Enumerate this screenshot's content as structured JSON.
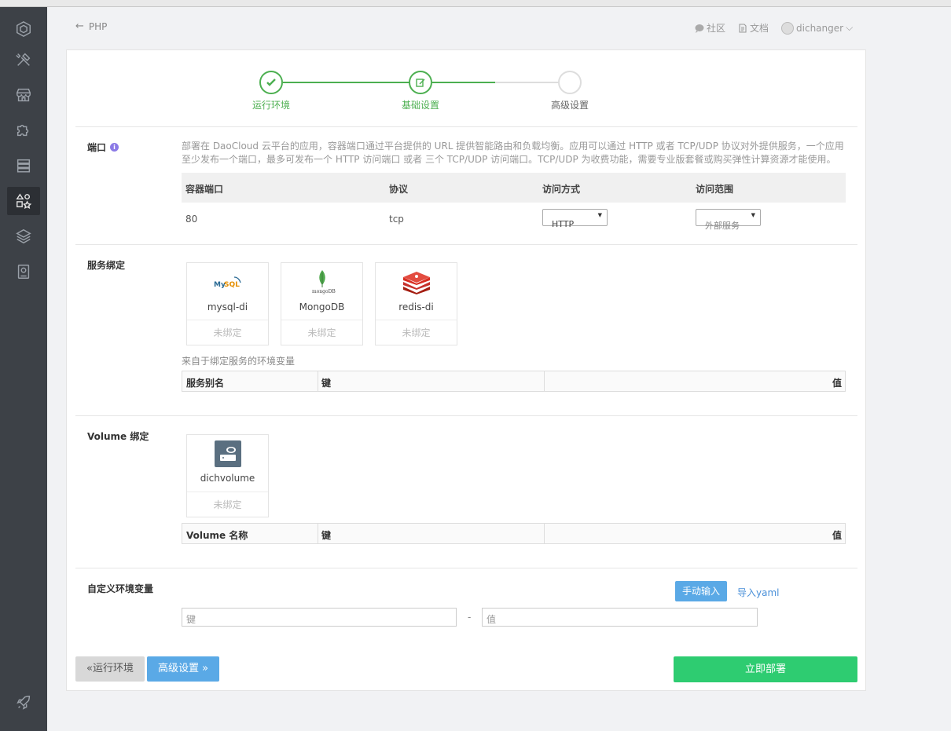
{
  "sidebar": {
    "items": [
      {
        "icon": "cube-logo-icon"
      },
      {
        "icon": "tools-icon"
      },
      {
        "icon": "store-icon"
      },
      {
        "icon": "puzzle-icon"
      },
      {
        "icon": "server-list-icon"
      },
      {
        "icon": "shapes-icon",
        "active": true
      },
      {
        "icon": "layers-icon"
      },
      {
        "icon": "disk-icon"
      },
      {
        "icon": "rocket-icon"
      }
    ]
  },
  "header": {
    "back_label": "PHP",
    "community": "社区",
    "docs": "文档",
    "user": "dichanger"
  },
  "steps": [
    {
      "label": "运行环境",
      "state": "done"
    },
    {
      "label": "基础设置",
      "state": "current"
    },
    {
      "label": "高级设置",
      "state": "todo"
    }
  ],
  "port": {
    "title": "端口",
    "description": "部署在 DaoCloud 云平台的应用，容器端口通过平台提供的 URL 提供智能路由和负载均衡。应用可以通过 HTTP 或者 TCP/UDP 协议对外提供服务，一个应用至少发布一个端口，最多可发布一个 HTTP 访问端口 或者 三个 TCP/UDP 访问端口。TCP/UDP 为收费功能，需要专业版套餐或购买弹性计算资源才能使用。",
    "columns": [
      "容器端口",
      "协议",
      "访问方式",
      "访问范围"
    ],
    "row": {
      "port": "80",
      "protocol": "tcp",
      "access": "HTTP",
      "scope": "外部服务"
    }
  },
  "service_binding": {
    "title": "服务绑定",
    "cards": [
      {
        "name": "mysql-di",
        "state": "未绑定",
        "logo": "mysql-logo-icon"
      },
      {
        "name": "MongoDB",
        "state": "未绑定",
        "logo": "mongodb-logo-icon"
      },
      {
        "name": "redis-di",
        "state": "未绑定",
        "logo": "redis-logo-icon"
      }
    ],
    "env_label": "来自于绑定服务的环境变量",
    "columns": [
      "服务别名",
      "键",
      "值"
    ]
  },
  "volume_binding": {
    "title": "Volume 绑定",
    "cards": [
      {
        "name": "dichvolume",
        "state": "未绑定",
        "logo": "volume-icon"
      }
    ],
    "columns": [
      "Volume 名称",
      "键",
      "值"
    ]
  },
  "custom_env": {
    "title": "自定义环境变量",
    "manual_button": "手动输入",
    "import_link": "导入yaml",
    "key_placeholder": "键",
    "value_placeholder": "值",
    "separator": "-"
  },
  "footer": {
    "prev_button": "«运行环境",
    "next_button": "高级设置 »",
    "deploy_button": "立即部署"
  },
  "colors": {
    "green": "#2ecc71",
    "step_green": "#4caf50",
    "blue": "#5aa9e6",
    "sidebar": "#3d4147"
  }
}
